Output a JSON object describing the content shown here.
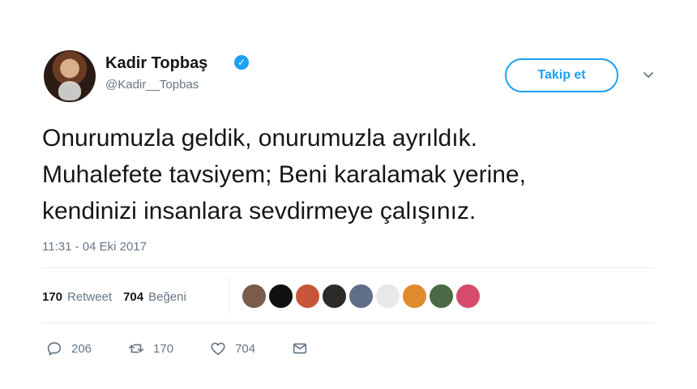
{
  "author": {
    "name": "Kadir Topbaş",
    "handle": "@Kadir__Topbas",
    "verified_glyph": "✓"
  },
  "header": {
    "follow_label": "Takip et"
  },
  "tweet": {
    "text": "Onurumuzla geldik, onurumuzla ayrıldık.\nMuhalefete tavsiyem; Beni  karalamak yerine,\nkendinizi insanlara sevdirmeye çalışınız.",
    "timestamp": "11:31 - 04 Eki 2017"
  },
  "stats": {
    "retweets_count": "170",
    "retweets_label": "Retweet",
    "likes_count": "704",
    "likes_label": "Beğeni"
  },
  "likers": [
    {
      "color": "#7a5c4b"
    },
    {
      "color": "#111111"
    },
    {
      "color": "#c7553a"
    },
    {
      "color": "#2b2b2b"
    },
    {
      "color": "#5f6f8a"
    },
    {
      "color": "#e8e8e8"
    },
    {
      "color": "#e08a2e"
    },
    {
      "color": "#4a6a45"
    },
    {
      "color": "#d64b6b"
    }
  ],
  "actions": {
    "reply_count": "206",
    "retweet_count": "170",
    "like_count": "704"
  },
  "icons": {
    "reply": "reply-icon",
    "retweet": "retweet-icon",
    "like": "heart-icon",
    "dm": "envelope-icon",
    "menu": "chevron-down-icon"
  },
  "colors": {
    "accent": "#1da1f2",
    "text_primary": "#14171a",
    "text_secondary": "#657786",
    "divider": "#e6ecf0"
  }
}
